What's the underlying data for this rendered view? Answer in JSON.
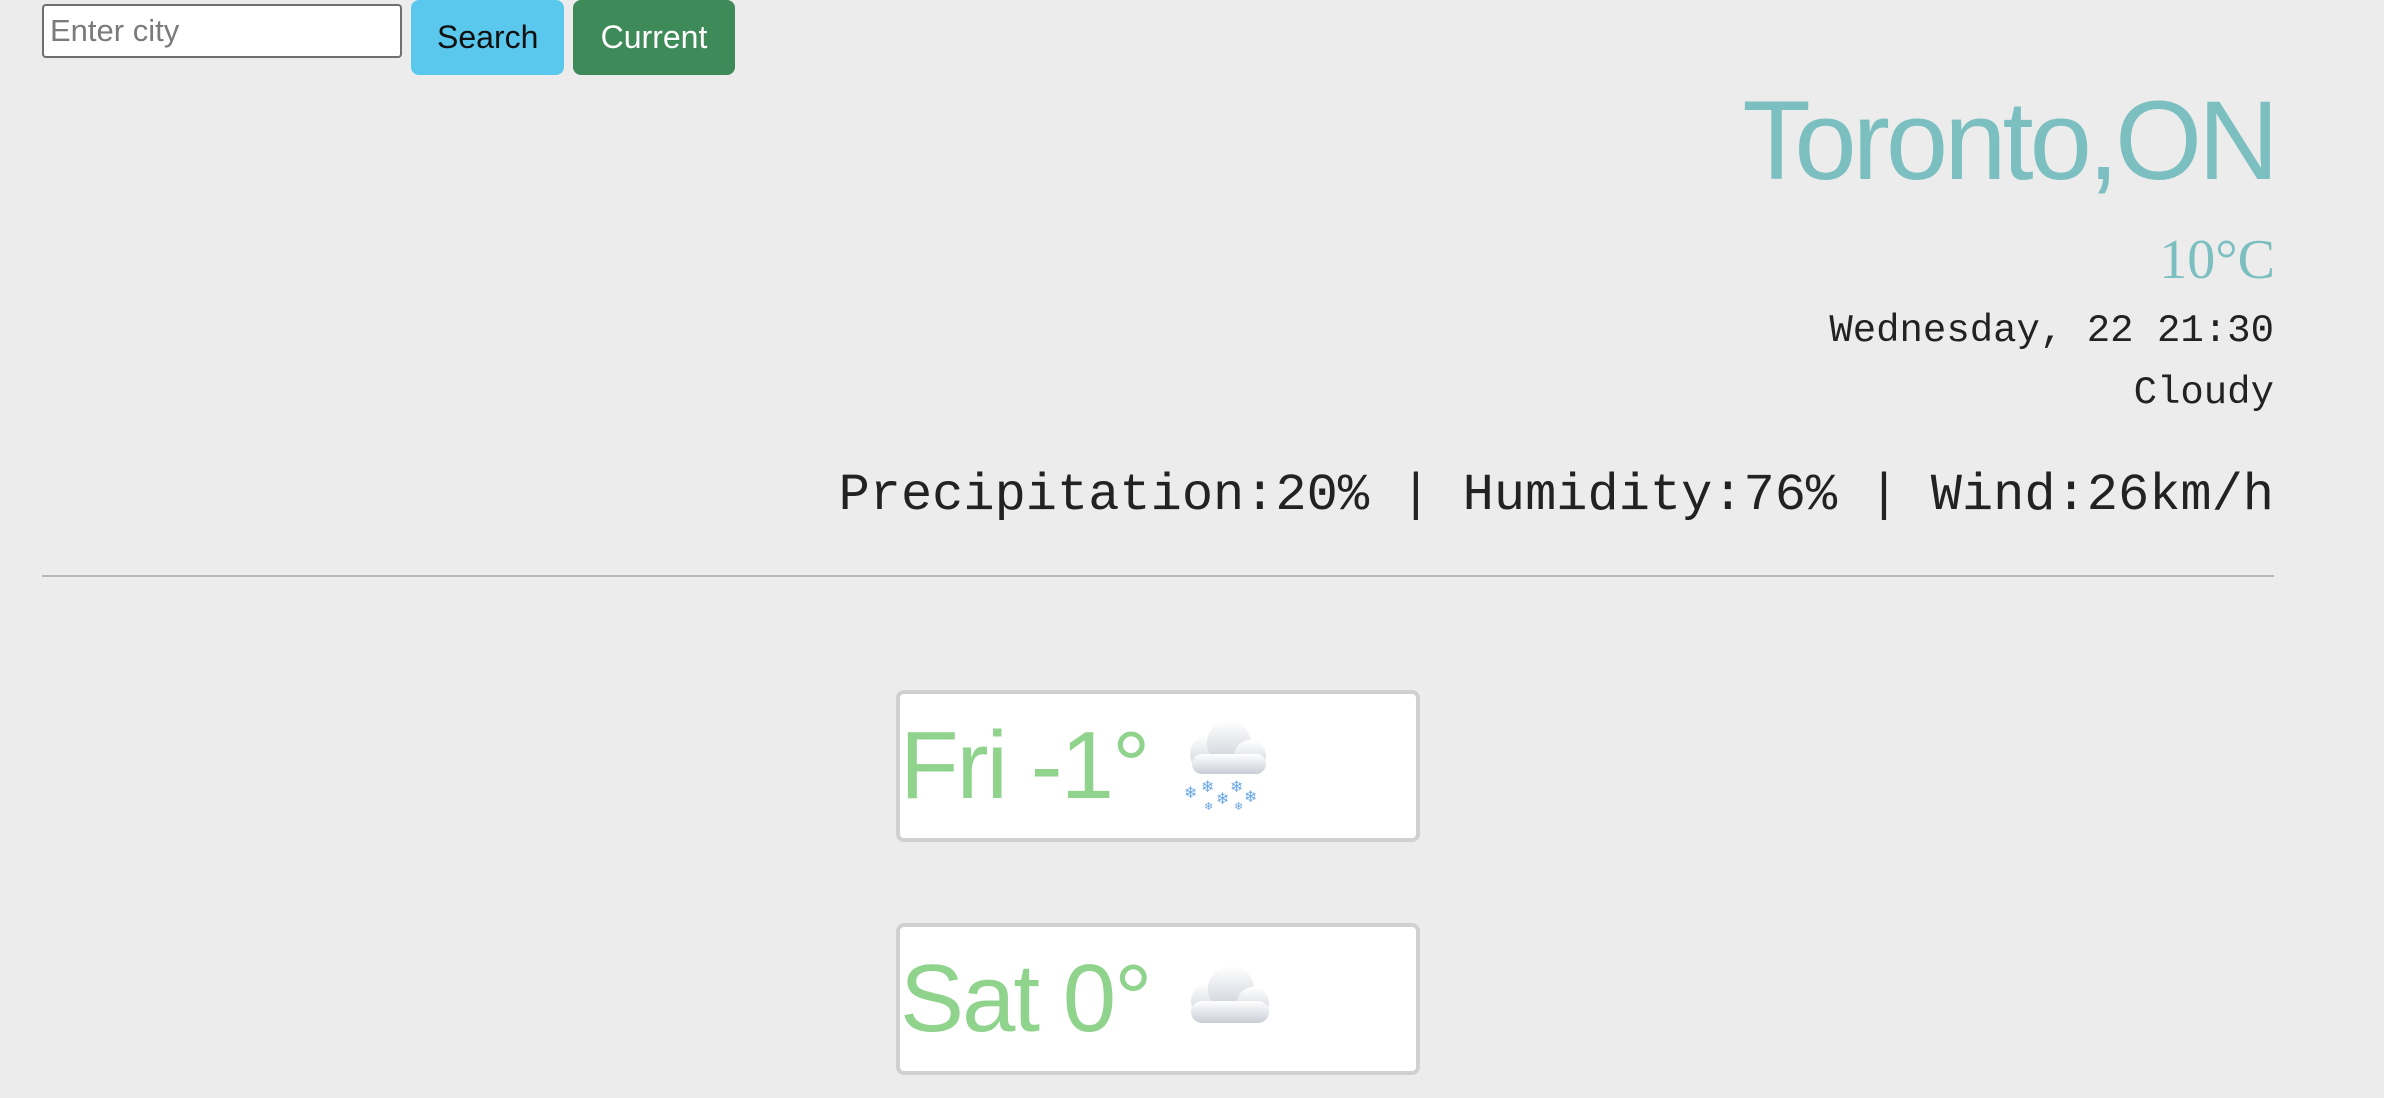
{
  "search": {
    "placeholder": "Enter city",
    "search_label": "Search",
    "current_label": "Current"
  },
  "current": {
    "city": "Toronto,ON",
    "temperature": "10°C",
    "datetime": "Wednesday, 22 21:30",
    "condition": "Cloudy",
    "stats": "Precipitation:20% | Humidity:76% | Wind:26km/h"
  },
  "forecast": [
    {
      "text": "Fri -1°",
      "icon": "snow-cloud-icon"
    },
    {
      "text": "Sat 0°",
      "icon": "cloud-icon"
    }
  ],
  "colors": {
    "background": "#ececec",
    "title": "#7bbfc0",
    "forecast_text": "#8fd38c",
    "search_button": "#5ac8ec",
    "current_button": "#3e8a58"
  }
}
